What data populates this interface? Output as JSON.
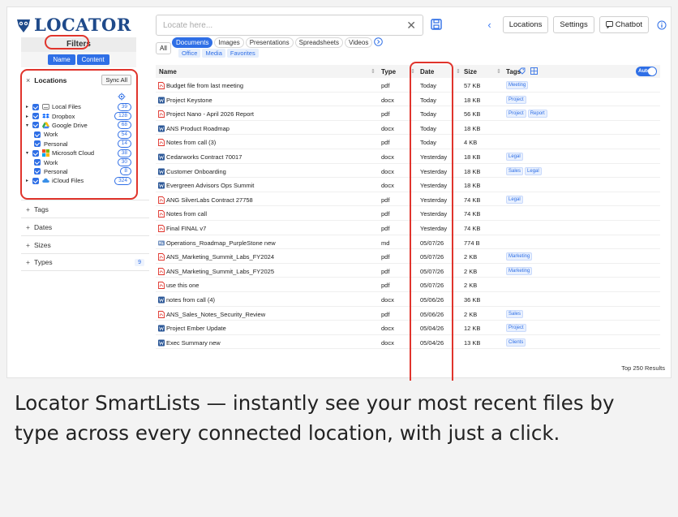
{
  "app": {
    "logo_text": "LOCATOR"
  },
  "search": {
    "placeholder": "Locate here..."
  },
  "top_buttons": {
    "locations": "Locations",
    "settings": "Settings",
    "chatbot": "Chatbot"
  },
  "filters": {
    "title": "Filters",
    "name": "Name",
    "content": "Content",
    "locations": {
      "label": "Locations",
      "sync": "Sync All",
      "items": [
        {
          "label": "Local Files",
          "count": "39",
          "child": false,
          "caret": "▸",
          "icon": "drive-icon"
        },
        {
          "label": "Dropbox",
          "count": "128",
          "child": false,
          "caret": "▸",
          "icon": "dropbox-icon"
        },
        {
          "label": "Google Drive",
          "count": "68",
          "child": false,
          "caret": "▾",
          "icon": "google-drive-icon"
        },
        {
          "label": "Work",
          "count": "54",
          "child": true
        },
        {
          "label": "Personal",
          "count": "14",
          "child": true
        },
        {
          "label": "Microsoft Cloud",
          "count": "38",
          "child": false,
          "caret": "▾",
          "icon": "microsoft-icon"
        },
        {
          "label": "Work",
          "count": "30",
          "child": true
        },
        {
          "label": "Personal",
          "count": "8",
          "child": true
        },
        {
          "label": "iCloud Files",
          "count": "324",
          "child": false,
          "caret": "▸",
          "icon": "icloud-icon"
        }
      ]
    },
    "sections": [
      {
        "label": "Tags"
      },
      {
        "label": "Dates"
      },
      {
        "label": "Sizes"
      },
      {
        "label": "Types",
        "badge": "9"
      }
    ]
  },
  "tabs": {
    "all": "All",
    "items": [
      "Documents",
      "Images",
      "Presentations",
      "Spreadsheets",
      "Videos"
    ],
    "subtabs": [
      "Office",
      "Media",
      "Favorites"
    ]
  },
  "table": {
    "headers": {
      "name": "Name",
      "type": "Type",
      "date": "Date",
      "size": "Size",
      "tags": "Tags"
    },
    "auto": "Auto",
    "rows": [
      {
        "name": "Budget file from last meeting",
        "type": "pdf",
        "date": "Today",
        "size": "57 KB",
        "tags": [
          "Meeting"
        ]
      },
      {
        "name": "Project Keystone",
        "type": "docx",
        "date": "Today",
        "size": "18 KB",
        "tags": [
          "Project"
        ]
      },
      {
        "name": "Project Nano - April 2026 Report",
        "type": "pdf",
        "date": "Today",
        "size": "56 KB",
        "tags": [
          "Project",
          "Report"
        ]
      },
      {
        "name": "ANS Product Roadmap",
        "type": "docx",
        "date": "Today",
        "size": "18 KB",
        "tags": []
      },
      {
        "name": "Notes from call (3)",
        "type": "pdf",
        "date": "Today",
        "size": "4 KB",
        "tags": []
      },
      {
        "name": "Cedarworks Contract 70017",
        "type": "docx",
        "date": "Yesterday",
        "size": "18 KB",
        "tags": [
          "Legal"
        ]
      },
      {
        "name": "Customer Onboarding",
        "type": "docx",
        "date": "Yesterday",
        "size": "18 KB",
        "tags": [
          "Sales",
          "Legal"
        ]
      },
      {
        "name": "Evergreen Advisors Ops Summit",
        "type": "docx",
        "date": "Yesterday",
        "size": "18 KB",
        "tags": []
      },
      {
        "name": "ANG SilverLabs Contract 27758",
        "type": "pdf",
        "date": "Yesterday",
        "size": "74 KB",
        "tags": [
          "Legal"
        ]
      },
      {
        "name": "Notes from call",
        "type": "pdf",
        "date": "Yesterday",
        "size": "74 KB",
        "tags": []
      },
      {
        "name": "Final FINAL v7",
        "type": "pdf",
        "date": "Yesterday",
        "size": "74 KB",
        "tags": []
      },
      {
        "name": "Operations_Roadmap_PurpleStone new",
        "type": "md",
        "date": "05/07/26",
        "size": "774 B",
        "tags": []
      },
      {
        "name": "ANS_Marketing_Summit_Labs_FY2024",
        "type": "pdf",
        "date": "05/07/26",
        "size": "2 KB",
        "tags": [
          "Marketing"
        ]
      },
      {
        "name": "ANS_Marketing_Summit_Labs_FY2025",
        "type": "pdf",
        "date": "05/07/26",
        "size": "2 KB",
        "tags": [
          "Marketing"
        ]
      },
      {
        "name": "use this one",
        "type": "pdf",
        "date": "05/07/26",
        "size": "2 KB",
        "tags": []
      },
      {
        "name": "notes from call (4)",
        "type": "docx",
        "date": "05/06/26",
        "size": "36 KB",
        "tags": []
      },
      {
        "name": "ANS_Sales_Notes_Security_Review",
        "type": "pdf",
        "date": "05/06/26",
        "size": "2 KB",
        "tags": [
          "Sales"
        ]
      },
      {
        "name": "Project Ember Update",
        "type": "docx",
        "date": "05/04/26",
        "size": "12 KB",
        "tags": [
          "Project"
        ]
      },
      {
        "name": "Exec Summary new",
        "type": "docx",
        "date": "05/04/26",
        "size": "13 KB",
        "tags": [
          "Clients"
        ]
      }
    ],
    "results": "Top 250 Results"
  },
  "caption": "Locator SmartLists — instantly see your most recent files by type across every connected location, with just a click.",
  "colors": {
    "accent": "#2f6fe6",
    "highlight": "#e0342c",
    "logo": "#1f4a8a",
    "pdf": "#e0342c",
    "docx": "#2b5797"
  }
}
